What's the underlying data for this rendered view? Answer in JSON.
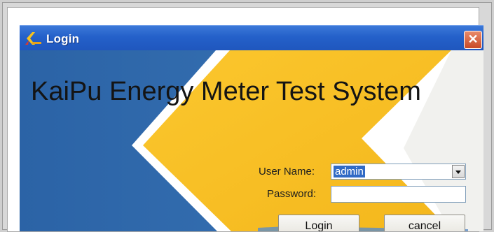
{
  "window": {
    "title": "Login",
    "close_glyph": "✕"
  },
  "app": {
    "heading": "KaiPu Energy Meter Test System"
  },
  "form": {
    "username_label": "User Name:",
    "username_value": "admin",
    "password_label": "Password:",
    "password_value": ""
  },
  "buttons": {
    "login": "Login",
    "cancel": "cancel"
  },
  "colors": {
    "titlebar": "#2460c9",
    "background_blue": "#2f66a8",
    "chevron_yellow": "#f8c333",
    "selection": "#316ac5"
  },
  "icons": {
    "app_icon": "kaipu-k-logo-icon",
    "close": "close-icon",
    "dropdown": "chevron-down-icon"
  }
}
